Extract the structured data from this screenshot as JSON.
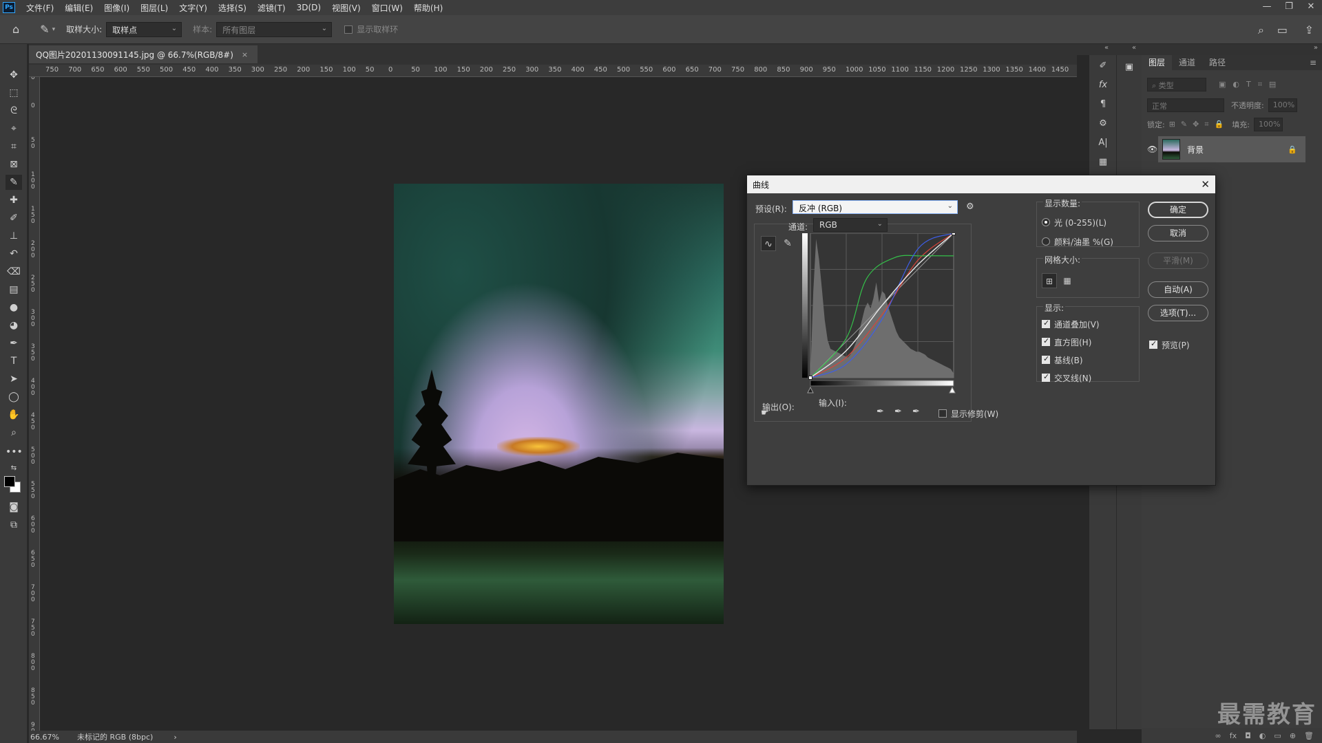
{
  "app": {
    "logo": "Ps",
    "menus": [
      "文件(F)",
      "编辑(E)",
      "图像(I)",
      "图层(L)",
      "文字(Y)",
      "选择(S)",
      "滤镜(T)",
      "3D(D)",
      "视图(V)",
      "窗口(W)",
      "帮助(H)"
    ],
    "window_controls": [
      "—",
      "❐",
      "✕"
    ]
  },
  "options_bar": {
    "sample_size_label": "取样大小:",
    "sample_size_value": "取样点",
    "sample_label": "样本:",
    "sample_value": "所有图层",
    "show_ring_label": "显示取样环"
  },
  "document": {
    "tab_title": "QQ图片20201130091145.jpg @ 66.7%(RGB/8#)",
    "tab_close": "×",
    "ruler_h": [
      "750",
      "700",
      "650",
      "600",
      "550",
      "500",
      "450",
      "400",
      "350",
      "300",
      "250",
      "200",
      "150",
      "100",
      "50",
      "0",
      "50",
      "100",
      "150",
      "200",
      "250",
      "300",
      "350",
      "400",
      "450",
      "500",
      "550",
      "600",
      "650",
      "700",
      "750",
      "800",
      "850",
      "900",
      "950",
      "1000",
      "1050",
      "1100",
      "1150",
      "1200",
      "1250",
      "1300",
      "1350",
      "1400",
      "1450"
    ],
    "ruler_v": [
      "50",
      "0",
      "50",
      "100",
      "150",
      "200",
      "250",
      "300",
      "350",
      "400",
      "450",
      "500",
      "550",
      "600",
      "650",
      "700",
      "750",
      "800",
      "850",
      "900"
    ]
  },
  "status": {
    "zoom": "66.67%",
    "profile": "未标记的 RGB (8bpc)",
    "arrow": "›"
  },
  "layers_panel": {
    "tabs": [
      "图层",
      "通道",
      "路径"
    ],
    "search_placeholder": "类型",
    "blend_mode": "正常",
    "opacity_label": "不透明度:",
    "opacity_value": "100%",
    "lock_label": "锁定:",
    "fill_label": "填充:",
    "fill_value": "100%",
    "layer_name": "背景"
  },
  "watermark": "最需教育",
  "curves_dialog": {
    "title": "曲线",
    "preset_label": "预设(R):",
    "preset_value": "反冲 (RGB)",
    "channel_label": "通道:",
    "channel_value": "RGB",
    "output_label": "输出(O):",
    "input_label": "输入(I):",
    "show_clipping_label": "显示修剪(W)",
    "show_amount_title": "显示数量:",
    "light_label": "光 (0-255)(L)",
    "pigment_label": "颜料/油墨 %(G)",
    "grid_size_title": "网格大小:",
    "show_title": "显示:",
    "channel_overlay_label": "通道叠加(V)",
    "histogram_label": "直方图(H)",
    "baseline_label": "基线(B)",
    "intersection_label": "交叉线(N)",
    "ok_label": "确定",
    "cancel_label": "取消",
    "smooth_label": "平滑(M)",
    "auto_label": "自动(A)",
    "options_label": "选项(T)...",
    "preview_label": "预览(P)",
    "light_selected": true,
    "channel_overlay_checked": true,
    "histogram_checked": true,
    "baseline_checked": true,
    "intersection_checked": true,
    "preview_checked": true,
    "show_clipping_checked": false,
    "curves": {
      "input_range": [
        0,
        255
      ],
      "output_range": [
        0,
        255
      ],
      "baseline": [
        [
          0,
          0
        ],
        [
          255,
          255
        ]
      ],
      "composite": [
        [
          0,
          0
        ],
        [
          64,
          48
        ],
        [
          128,
          128
        ],
        [
          192,
          200
        ],
        [
          255,
          255
        ]
      ],
      "red": [
        [
          0,
          0
        ],
        [
          64,
          36
        ],
        [
          128,
          112
        ],
        [
          192,
          208
        ],
        [
          255,
          255
        ]
      ],
      "green": [
        [
          0,
          0
        ],
        [
          64,
          70
        ],
        [
          100,
          175
        ],
        [
          150,
          212
        ],
        [
          200,
          215
        ],
        [
          255,
          215
        ]
      ],
      "blue": [
        [
          0,
          0
        ],
        [
          64,
          24
        ],
        [
          128,
          104
        ],
        [
          192,
          228
        ],
        [
          255,
          255
        ]
      ],
      "colors": {
        "composite": "#e8e8e8",
        "red": "#d9443a",
        "green": "#35c14a",
        "blue": "#3e5ee8"
      }
    },
    "histogram": [
      2,
      60,
      96,
      82,
      62,
      40,
      26,
      20,
      19,
      18,
      17,
      16,
      15,
      14,
      16,
      20,
      25,
      32,
      40,
      48,
      52,
      48,
      55,
      66,
      52,
      60,
      58,
      50,
      44,
      38,
      32,
      28,
      26,
      24,
      22,
      20,
      19,
      18,
      18,
      17,
      16,
      14,
      13,
      12,
      11,
      10,
      9,
      8,
      7,
      6,
      3
    ]
  }
}
